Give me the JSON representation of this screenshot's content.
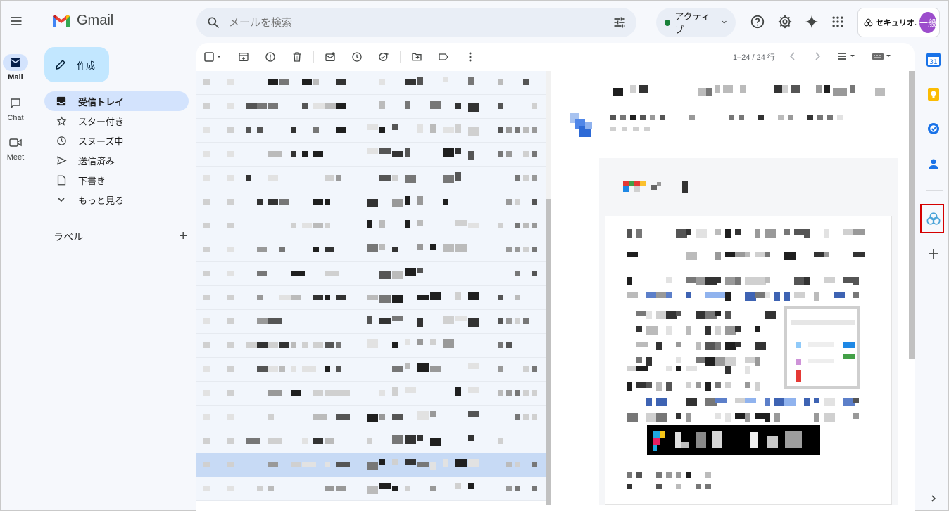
{
  "app": {
    "name": "Gmail"
  },
  "search": {
    "placeholder": "メールを検索"
  },
  "status": {
    "label": "アクティブ",
    "color": "#188038"
  },
  "account": {
    "org": "セキュリオ.",
    "avatar_text": "一般",
    "avatar_color": "#9c4dcc"
  },
  "rail": {
    "items": [
      {
        "label": "Mail",
        "icon": "mail-icon",
        "active": true
      },
      {
        "label": "Chat",
        "icon": "chat-icon",
        "active": false
      },
      {
        "label": "Meet",
        "icon": "meet-icon",
        "active": false
      }
    ]
  },
  "compose": {
    "label": "作成"
  },
  "nav": {
    "items": [
      {
        "label": "受信トレイ",
        "icon": "inbox-icon",
        "active": true
      },
      {
        "label": "スター付き",
        "icon": "star-icon",
        "active": false
      },
      {
        "label": "スヌーズ中",
        "icon": "clock-icon",
        "active": false
      },
      {
        "label": "送信済み",
        "icon": "send-icon",
        "active": false
      },
      {
        "label": "下書き",
        "icon": "draft-icon",
        "active": false
      },
      {
        "label": "もっと見る",
        "icon": "chevron-down-icon",
        "active": false
      }
    ],
    "labels_heading": "ラベル",
    "labels_add": "+"
  },
  "toolbar": {
    "pager": "1–24 / 24 行"
  },
  "colors": {
    "accent": "#0b57d0",
    "selected_row": "#c2e7ff",
    "highlight_frame": "#d50000"
  },
  "side_panel": {
    "icons": [
      "calendar-icon",
      "keep-icon",
      "tasks-icon",
      "contacts-icon",
      "securio-addon-icon",
      "add-icon",
      "expand-icon"
    ]
  }
}
